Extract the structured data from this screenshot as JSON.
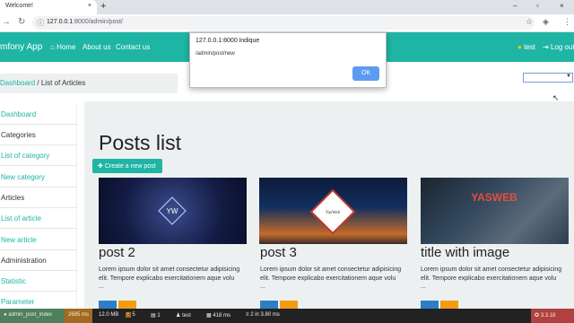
{
  "browser": {
    "tab_title": "Welcome!",
    "tab_close": "×",
    "new_tab": "+",
    "win_min": "–",
    "win_max": "▫",
    "win_close": "×",
    "url_host": "127.0.0.1",
    "url_path": ":8000/admin/post/",
    "info_icon": "ⓘ"
  },
  "navbar": {
    "brand": "mfony App",
    "home": "Home",
    "about": "About us",
    "contact": "Contact us",
    "user": "test",
    "logout": "Log out"
  },
  "breadcrumb": {
    "dashboard": "Dashboard",
    "sep": "/",
    "current": "List of Articles"
  },
  "sidebar": {
    "items": [
      {
        "label": "Dashboard"
      },
      {
        "label": "Categories"
      },
      {
        "label": "List of category"
      },
      {
        "label": "New category"
      },
      {
        "label": "Articles"
      },
      {
        "label": "List of article"
      },
      {
        "label": "New article"
      },
      {
        "label": "Administration"
      },
      {
        "label": "Statistic"
      },
      {
        "label": "Parameter"
      }
    ]
  },
  "main": {
    "title": "Posts list",
    "create_label": "Create a new post",
    "cards": [
      {
        "title": "post 2",
        "text": "Lorem ipsum dolor sit amet consectetur adipisicing elit. Tempore explicabo exercitationem aque volu",
        "more": "...",
        "img_label": "YW"
      },
      {
        "title": "post 3",
        "text": "Lorem ipsum dolor sit amet consectetur adipisicing elit. Tempore explicabo exercitationem aque volu",
        "more": "...",
        "img_label": "YasWeb"
      },
      {
        "title": "title with image",
        "text": "Lorem ipsum dolor sit amet consectetur adipisicing elit. Tempore explicabo exercitationem aque volu",
        "more": "...",
        "img_label": "YASWEB"
      }
    ]
  },
  "alert": {
    "title": "127.0.0.1:8000 indique",
    "message": "/admin/post/new",
    "ok": "OK"
  },
  "profiler": {
    "route": "admin_post_index",
    "status_ms": "2685 ms",
    "memory": "12.0 MB",
    "errors": "5",
    "forms": "1",
    "user": "test",
    "time": "418 ms",
    "db": "2 in 3.80 ms",
    "version": "3.3.18"
  },
  "colors": {
    "accent": "#1fb5a5",
    "main_bg": "#ecf0f1",
    "profiler_bg": "#222222"
  }
}
